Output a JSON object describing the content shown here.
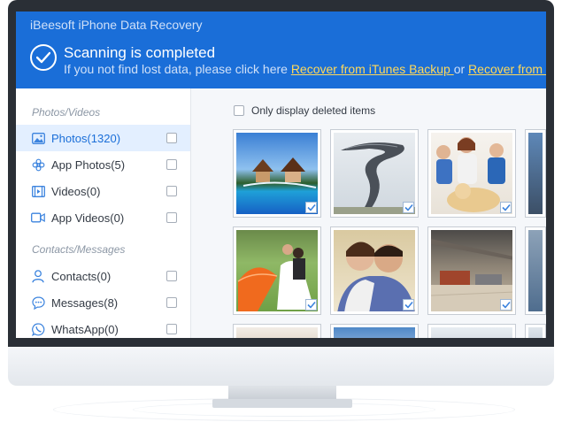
{
  "app": {
    "title": "iBeesoft iPhone Data Recovery"
  },
  "header": {
    "status_title": "Scanning is completed",
    "status_text": "If you not find lost data, please click here ",
    "link_itunes": "Recover from iTunes Backup ",
    "or_text": " or ",
    "link_icloud": "Recover from iCloud Backup"
  },
  "sidebar": {
    "photos_section": "Photos/Videos",
    "contacts_section": "Contacts/Messages",
    "items": [
      {
        "label": "Photos(1320)",
        "icon": "image-icon",
        "selected": true
      },
      {
        "label": "App Photos(5)",
        "icon": "flower-icon",
        "selected": false
      },
      {
        "label": "Videos(0)",
        "icon": "film-icon",
        "selected": false
      },
      {
        "label": "App Videos(0)",
        "icon": "video-camera-icon",
        "selected": false
      },
      {
        "label": "Contacts(0)",
        "icon": "person-icon",
        "selected": false
      },
      {
        "label": "Messages(8)",
        "icon": "chat-bubble-icon",
        "selected": false
      },
      {
        "label": "WhatsApp(0)",
        "icon": "whatsapp-icon",
        "selected": false
      }
    ]
  },
  "main": {
    "filter_label": "Only display deleted items",
    "thumbnails": [
      {
        "subject": "resort-pool",
        "checked": true
      },
      {
        "subject": "spiral-sculpture",
        "checked": true
      },
      {
        "subject": "family-with-dog",
        "checked": true
      },
      {
        "subject": "wedding-umbrella",
        "checked": true
      },
      {
        "subject": "couple-portrait",
        "checked": true
      },
      {
        "subject": "indoor-hall",
        "checked": true
      }
    ]
  },
  "colors": {
    "header_bg": "#1a6ed8",
    "link": "#ffd95a",
    "selected_bg": "#e3efff"
  }
}
